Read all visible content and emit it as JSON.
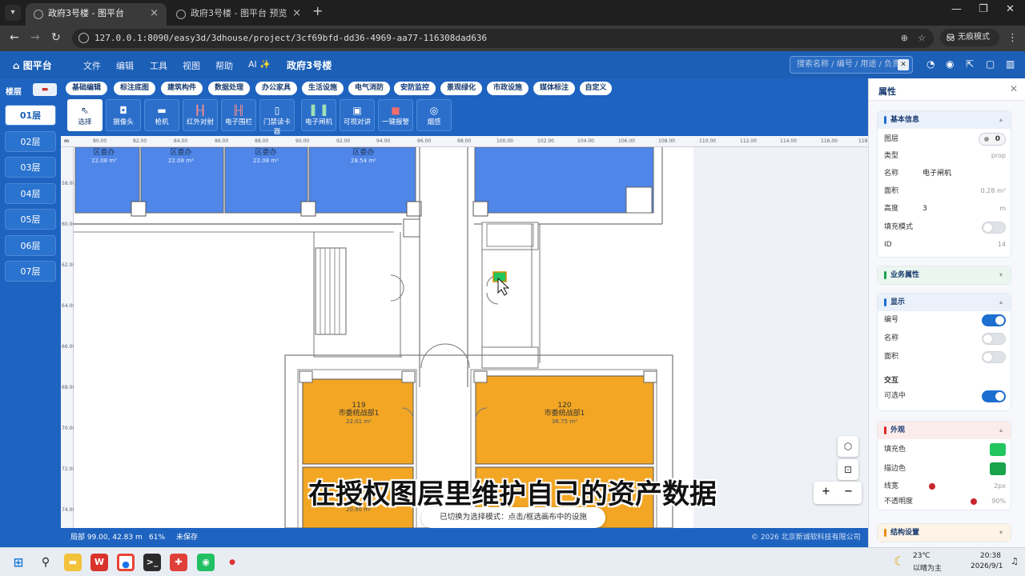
{
  "browser": {
    "tabs": [
      {
        "title": "政府3号楼 - 图平台"
      },
      {
        "title": "政府3号楼 - 图平台 预览"
      }
    ],
    "url": "127.0.0.1:8090/easy3d/3dhouse/project/3cf69bfd-dd36-4969-aa77-116308dad636",
    "incognito_label": "无痕模式"
  },
  "app": {
    "logo": "图平台",
    "menu": [
      "文件",
      "编辑",
      "工具",
      "视图",
      "帮助",
      "AI ✨"
    ],
    "project_title": "政府3号楼",
    "search_placeholder": "搜索名称 / 编号 / 用途 / 负责"
  },
  "floors": {
    "header": "楼层",
    "items": [
      "01层",
      "02层",
      "03层",
      "04层",
      "05层",
      "06层",
      "07层"
    ],
    "active": "01层"
  },
  "categories": {
    "items": [
      "基础编辑",
      "标注底图",
      "建筑构件",
      "数据处理",
      "办公家具",
      "生活设施",
      "电气消防",
      "安防监控",
      "景观绿化",
      "市政设施",
      "媒体标注",
      "自定义"
    ],
    "active": "安防监控"
  },
  "tools": {
    "items": [
      {
        "label": "选择",
        "icon": "cursor-arrow-icon"
      },
      {
        "label": "摄像头",
        "icon": "camera-icon"
      },
      {
        "label": "枪机",
        "icon": "bullet-camera-icon"
      },
      {
        "label": "红外对射",
        "icon": "infrared-beam-icon"
      },
      {
        "label": "电子围栏",
        "icon": "electronic-fence-icon"
      },
      {
        "label": "门禁读卡器",
        "icon": "card-reader-icon"
      },
      {
        "label": "电子闸机",
        "icon": "turnstile-icon"
      },
      {
        "label": "可视对讲",
        "icon": "video-intercom-icon"
      },
      {
        "label": "一键报警",
        "icon": "alarm-button-icon"
      },
      {
        "label": "烟感",
        "icon": "smoke-detector-icon"
      }
    ],
    "active": "选择"
  },
  "ruler": {
    "unit": "m",
    "x_ticks": [
      "80.00",
      "82.00",
      "84.00",
      "86.00",
      "88.00",
      "90.00",
      "92.00",
      "94.00",
      "96.00",
      "98.00",
      "100.00",
      "102.00",
      "104.00",
      "106.00",
      "108.00",
      "110.00",
      "112.00",
      "114.00",
      "116.00",
      "118.00"
    ],
    "y_ticks": [
      "58.00",
      "60.00",
      "62.00",
      "64.00",
      "66.00",
      "68.00",
      "70.00",
      "72.00",
      "74.00"
    ]
  },
  "rooms": {
    "blue": [
      {
        "name": "区委办",
        "area": "22.08 m²"
      },
      {
        "name": "区委办",
        "area": "22.08 m²"
      },
      {
        "name": "区委办",
        "area": "22.08 m²"
      },
      {
        "name": "区委办",
        "area": "28.54 m²"
      }
    ],
    "orange": [
      {
        "number": "119",
        "name": "市委统战部1",
        "area": "22.01 m²"
      },
      {
        "number": "120",
        "name": "市委统战部1",
        "area": "36.75 m²"
      },
      {
        "number": "",
        "name": "",
        "area": "20.90 m²"
      }
    ]
  },
  "canvas": {
    "toast": "已切换为选择模式：点击/框选画布中的设施",
    "subtitle": "在授权图层里维护自己的资产数据"
  },
  "status": {
    "coords": "局部 99.00, 42.83 m",
    "zoom": "61%",
    "save_state": "未保存",
    "copyright": "© 2026 北京新诚软科技有限公司"
  },
  "properties": {
    "title": "属性",
    "basic": {
      "header": "基本信息",
      "layer_label": "图层",
      "layer_value": "0",
      "type_label": "类型",
      "type_value": "prop",
      "name_label": "名称",
      "name_value": "电子闸机",
      "area_label": "面积",
      "area_value": "0.28 m²",
      "height_label": "高度",
      "height_value": "3",
      "height_unit": "m",
      "fill_label": "填充模式",
      "fill_on": false,
      "id_label": "ID",
      "id_value": "14"
    },
    "business": {
      "header": "业务属性"
    },
    "display": {
      "header": "显示",
      "number_label": "编号",
      "number_on": true,
      "name_label": "名称",
      "name_on": false,
      "area_label": "面积",
      "area_on": false,
      "interact_header": "交互",
      "selectable_label": "可选中",
      "selectable_on": true
    },
    "appearance": {
      "header": "外观",
      "fill_label": "填充色",
      "fill_color": "#22c55e",
      "stroke_label": "描边色",
      "stroke_color": "#16a34a",
      "width_label": "线宽",
      "width_value": "2px",
      "opacity_label": "不透明度",
      "opacity_value": "90%"
    },
    "structure": {
      "header": "结构设置"
    }
  },
  "taskbar": {
    "weather_temp": "23℃",
    "weather_desc": "以晴为主",
    "time": "20:38",
    "date": "2026/9/1"
  },
  "colors": {
    "brand": "#1b5fb6",
    "room_blue": "#4f86e8",
    "room_orange": "#f2a623",
    "toggle_on": "#1c6fd1"
  }
}
